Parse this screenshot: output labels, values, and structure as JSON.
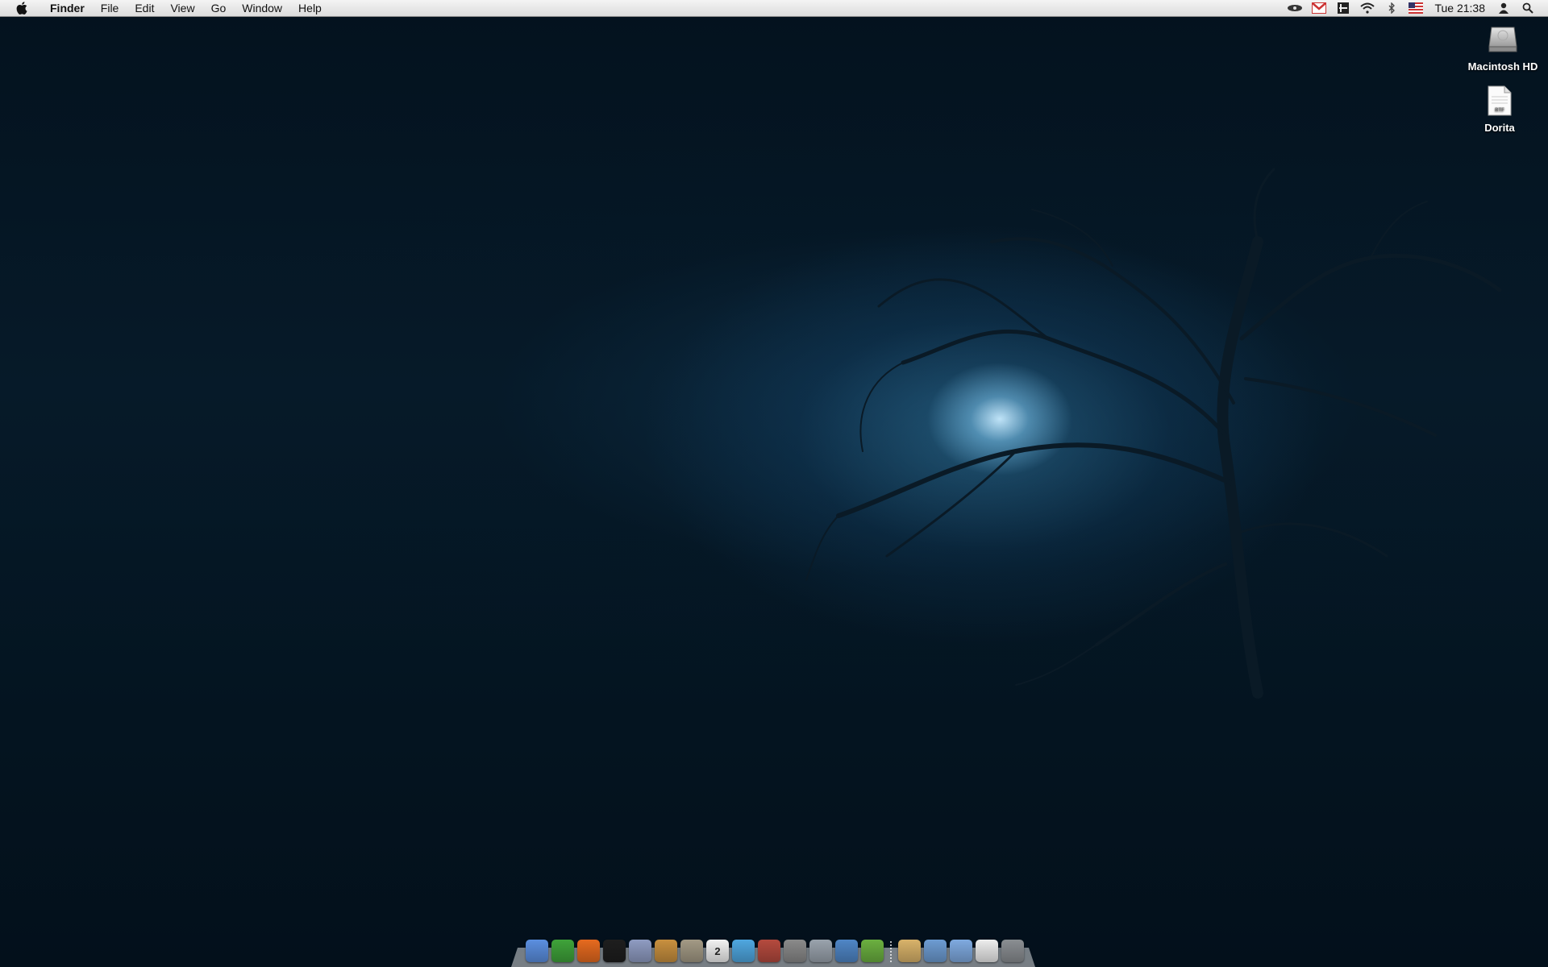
{
  "menubar": {
    "apple_icon": "apple-icon",
    "app_name": "Finder",
    "menus": [
      "File",
      "Edit",
      "View",
      "Go",
      "Window",
      "Help"
    ],
    "status_icons": [
      "eye-icon",
      "gmail-icon",
      "dashboard-icon",
      "wifi-icon",
      "bluetooth-icon",
      "us-flag-icon"
    ],
    "clock": "Tue 21:38",
    "right_icons": [
      "user-icon",
      "spotlight-icon"
    ]
  },
  "desktop": {
    "icons": [
      {
        "label": "Macintosh HD",
        "icon": "hard-drive-icon"
      },
      {
        "label": "Dorita",
        "icon": "rtf-document-icon",
        "badge": "RTF"
      }
    ]
  },
  "dock": {
    "apps": [
      {
        "name": "finder-icon",
        "color": "#5b8fe0"
      },
      {
        "name": "adium-icon",
        "color": "#3fa33a"
      },
      {
        "name": "firefox-icon",
        "color": "#e66a1f"
      },
      {
        "name": "terminal-icon",
        "color": "#1e1e1e"
      },
      {
        "name": "script-editor-icon",
        "color": "#8f9cc2"
      },
      {
        "name": "preview-icon",
        "color": "#c8903f"
      },
      {
        "name": "app-store-icon",
        "color": "#a39a85"
      },
      {
        "name": "ical-icon",
        "color": "#f2f2f2",
        "text": "2"
      },
      {
        "name": "itunes-icon",
        "color": "#4fa7e0"
      },
      {
        "name": "address-book-icon",
        "color": "#b54a3e"
      },
      {
        "name": "system-preferences-icon",
        "color": "#8a8a8a"
      },
      {
        "name": "utility-icon",
        "color": "#9aa3ad"
      },
      {
        "name": "word-icon",
        "color": "#4f86c6"
      },
      {
        "name": "linkage-icon",
        "color": "#6bb040"
      }
    ],
    "stacks": [
      {
        "name": "documents-stack-icon",
        "color": "#d9b36a"
      },
      {
        "name": "applications-folder-icon",
        "color": "#6d9cd2"
      },
      {
        "name": "downloads-folder-icon",
        "color": "#7faae0"
      },
      {
        "name": "document-stack-icon",
        "color": "#ededed"
      },
      {
        "name": "trash-icon",
        "color": "#8a8e92"
      }
    ]
  }
}
